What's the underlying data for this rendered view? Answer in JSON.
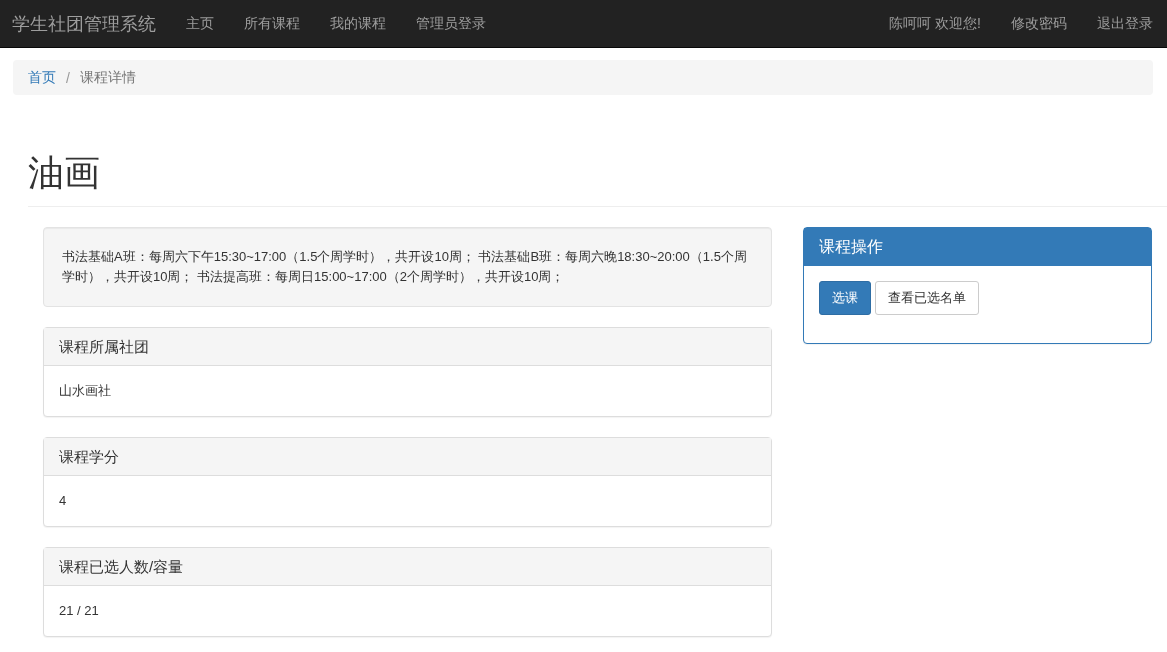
{
  "navbar": {
    "brand": "学生社团管理系统",
    "links": [
      {
        "label": "主页",
        "selected": false
      },
      {
        "label": "所有课程",
        "selected": false
      },
      {
        "label": "我的课程",
        "selected": false
      },
      {
        "label": "管理员登录",
        "selected": false
      }
    ],
    "user_links": [
      {
        "label": "陈呵呵 欢迎您!"
      },
      {
        "label": "修改密码"
      },
      {
        "label": "退出登录"
      }
    ]
  },
  "breadcrumb": [
    {
      "label": "首页",
      "kind": "link"
    },
    {
      "label": "课程详情",
      "kind": "active"
    }
  ],
  "breadcrumb_separator": "/",
  "title": "油画",
  "description": "书法基础A班：每周六下午15:30~17:00（1.5个周学时），共开设10周； 书法基础B班：每周六晚18:30~20:00（1.5个周学时），共开设10周； 书法提高班：每周日15:00~17:00（2个周学时），共开设10周；",
  "panels": [
    {
      "heading": "课程所属社团",
      "body": "山水画社"
    },
    {
      "heading": "课程学分",
      "body": "4"
    },
    {
      "heading": "课程已选人数/容量",
      "body": "21 / 21"
    }
  ],
  "actions": {
    "heading": "课程操作",
    "buttons": [
      {
        "label": "选课",
        "kind": "primary"
      },
      {
        "label": "查看已选名单",
        "kind": "default"
      }
    ]
  }
}
